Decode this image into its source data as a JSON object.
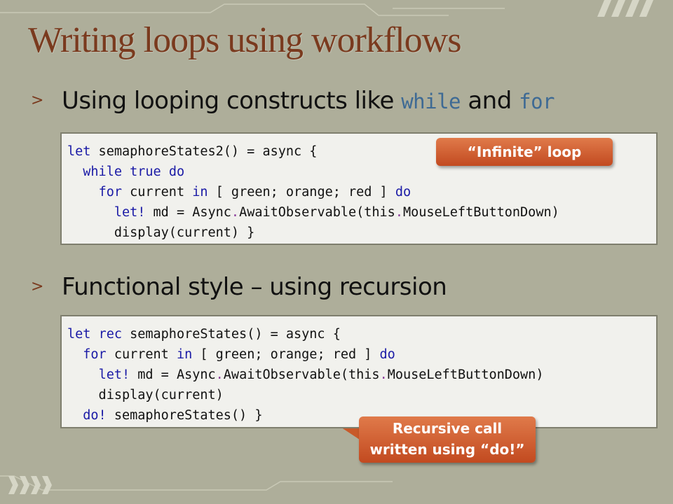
{
  "slide": {
    "title": "Writing loops using workflows",
    "bullets": [
      {
        "arrow": ">",
        "text_before": "Using looping constructs like ",
        "code1": "while",
        "text_mid": " and ",
        "code2": "for"
      },
      {
        "arrow": ">",
        "text": "Functional style – using recursion"
      }
    ],
    "code_block_1": [
      [
        "let",
        " semaphoreStates2() = async {"
      ],
      [
        "  ",
        "while",
        " ",
        "true",
        " ",
        "do"
      ],
      [
        "    ",
        "for",
        " current ",
        "in",
        " [ green; orange; red ] ",
        "do"
      ],
      [
        "      ",
        "let!",
        " md = Async",
        ".",
        "AwaitObservable(this",
        ".",
        "MouseLeftButtonDown)"
      ],
      [
        "      display(current) }"
      ]
    ],
    "code_block_2": [
      [
        "let",
        " ",
        "rec",
        " semaphoreStates() = async {"
      ],
      [
        "  ",
        "for",
        " current ",
        "in",
        " [ green; orange; red ] ",
        "do"
      ],
      [
        "    ",
        "let!",
        " md = Async",
        ".",
        "AwaitObservable(this",
        ".",
        "MouseLeftButtonDown)"
      ],
      [
        "    display(current)"
      ],
      [
        "  ",
        "do!",
        " semaphoreStates() }"
      ]
    ],
    "callout_1": "“Infinite” loop",
    "callout_2_line1": "Recursive call",
    "callout_2_line2": "written using “do!”",
    "colors": {
      "title": "#7a3a1e",
      "background": "#aeae9a",
      "callout": "#d0602e",
      "code_inline": "#3e6a94",
      "keyword": "#1a1aa6"
    }
  }
}
